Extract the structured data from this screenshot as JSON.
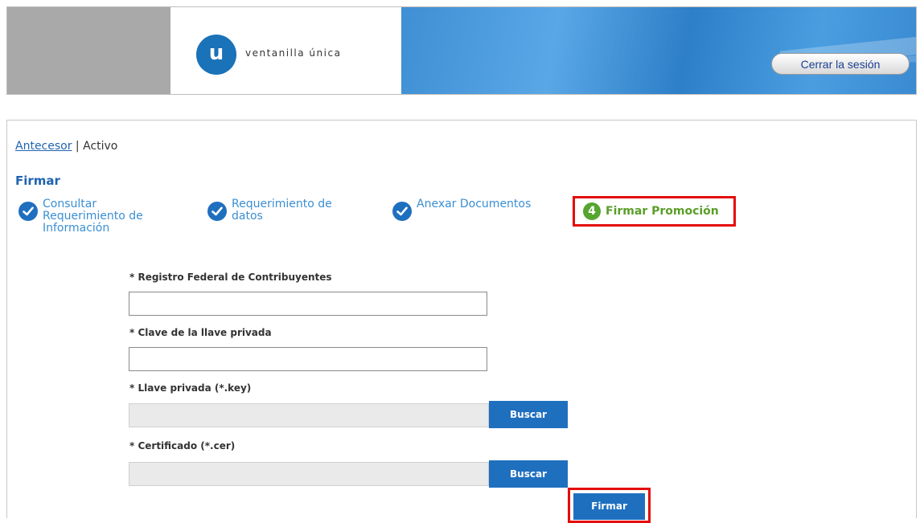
{
  "header": {
    "logo_letter": "u",
    "logo_text": "ventanilla única",
    "logout_label": "Cerrar la sesión"
  },
  "breadcrumb": {
    "link": "Antecesor",
    "separator": " | ",
    "current": "Activo"
  },
  "page_title": "Firmar",
  "steps": [
    {
      "label_lines": [
        "Consultar",
        "Requerimiento de",
        "Información"
      ],
      "status": "done"
    },
    {
      "label_lines": [
        "Requerimiento de",
        "datos"
      ],
      "status": "done"
    },
    {
      "label_lines": [
        "Anexar Documentos"
      ],
      "status": "done"
    },
    {
      "number": "4",
      "label": "Firmar Promoción",
      "status": "active"
    }
  ],
  "form": {
    "rfc_label": "* Registro Federal de Contribuyentes",
    "rfc_value": "",
    "key_password_label": "* Clave de la llave privada",
    "key_password_value": "",
    "private_key_label": "* Llave privada (*.key)",
    "private_key_file": "",
    "certificate_label": "* Certificado (*.cer)",
    "certificate_file": "",
    "browse_label": "Buscar",
    "sign_label": "Firmar"
  },
  "colors": {
    "primary_blue": "#1f6fbf",
    "link_blue": "#1f64b0",
    "active_green": "#5a9e28",
    "highlight_red": "#e40b0b"
  }
}
